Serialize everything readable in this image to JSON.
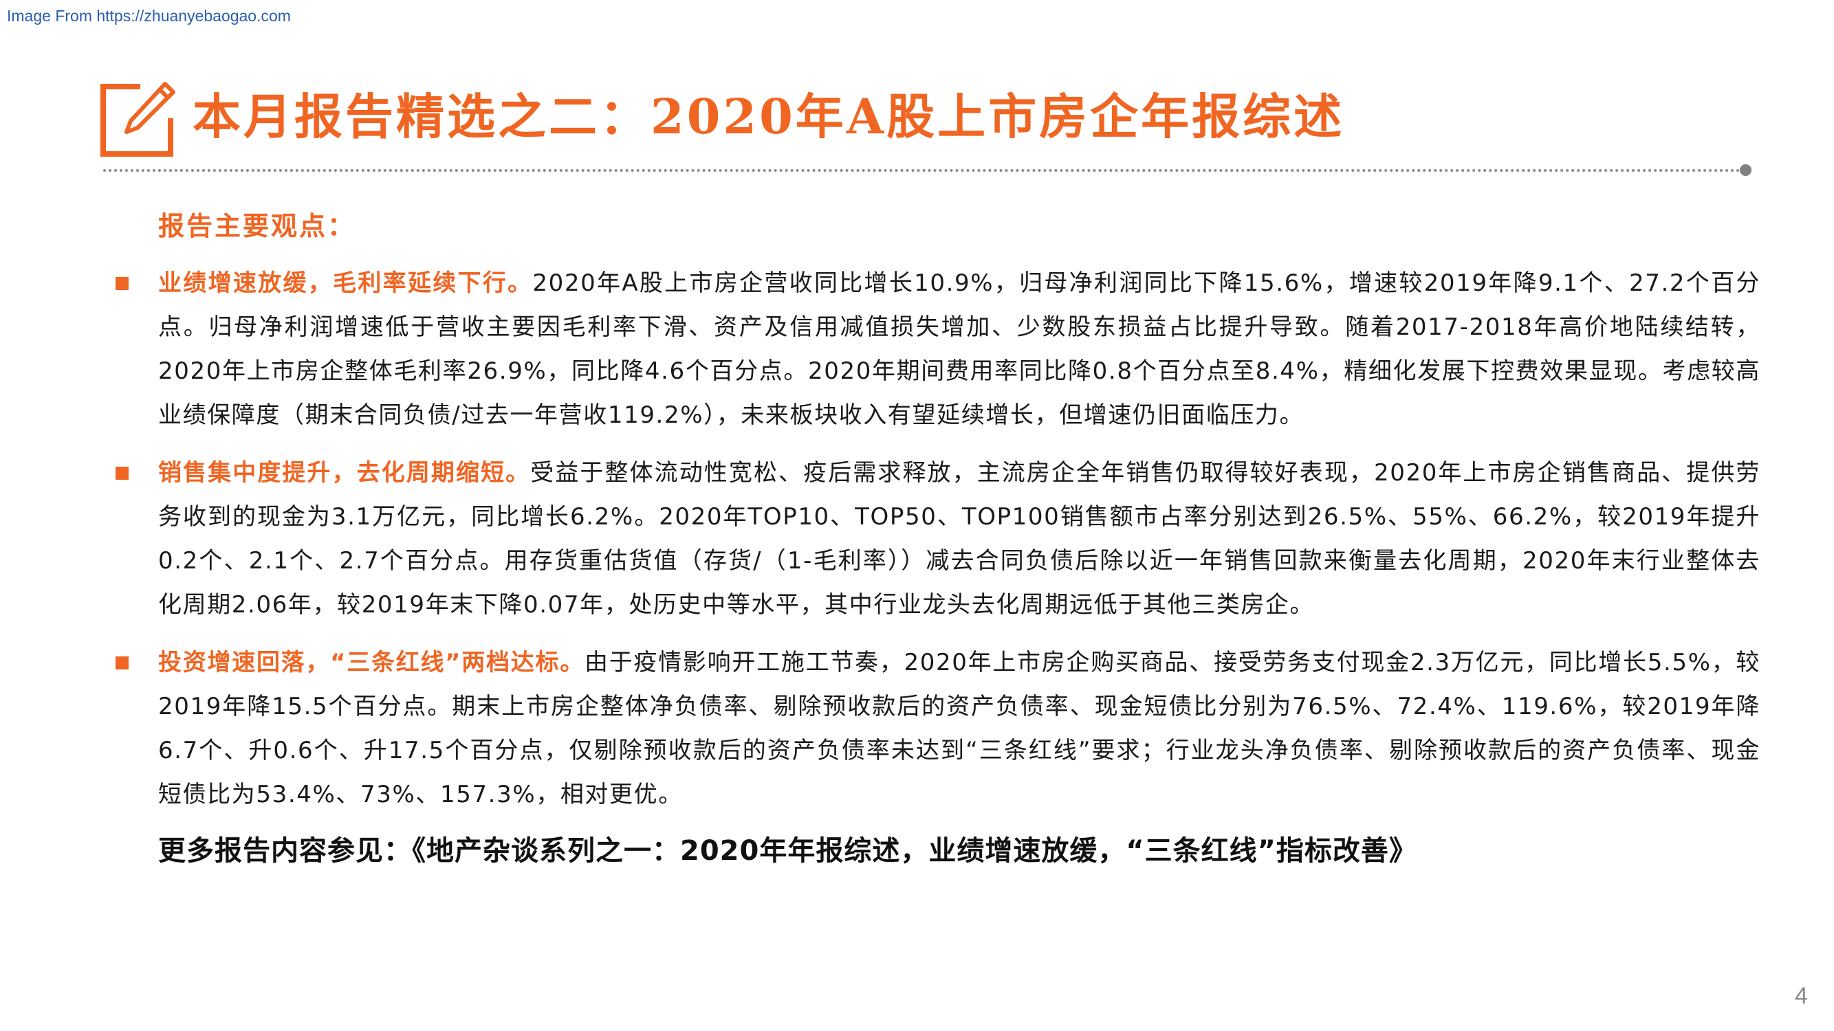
{
  "source_text": "Image From https://zhuanyebaogao.com",
  "slide": {
    "title": "本月报告精选之二：2020年A股上市房企年报综述",
    "section_heading": "报告主要观点：",
    "points": [
      {
        "lead": "业绩增速放缓，毛利率延续下行。",
        "body": "2020年A股上市房企营收同比增长10.9%，归母净利润同比下降15.6%，增速较2019年降9.1个、27.2个百分点。归母净利润增速低于营收主要因毛利率下滑、资产及信用减值损失增加、少数股东损益占比提升导致。随着2017-2018年高价地陆续结转，2020年上市房企整体毛利率26.9%，同比降4.6个百分点。2020年期间费用率同比降0.8个百分点至8.4%，精细化发展下控费效果显现。考虑较高业绩保障度（期末合同负债/过去一年营收119.2%），未来板块收入有望延续增长，但增速仍旧面临压力。"
      },
      {
        "lead": "销售集中度提升，去化周期缩短。",
        "body": "受益于整体流动性宽松、疫后需求释放，主流房企全年销售仍取得较好表现，2020年上市房企销售商品、提供劳务收到的现金为3.1万亿元，同比增长6.2%。2020年TOP10、TOP50、TOP100销售额市占率分别达到26.5%、55%、66.2%，较2019年提升0.2个、2.1个、2.7个百分点。用存货重估货值（存货/（1-毛利率））减去合同负债后除以近一年销售回款来衡量去化周期，2020年末行业整体去化周期2.06年，较2019年末下降0.07年，处历史中等水平，其中行业龙头去化周期远低于其他三类房企。"
      },
      {
        "lead": "投资增速回落，“三条红线”两档达标。",
        "body": "由于疫情影响开工施工节奏，2020年上市房企购买商品、接受劳务支付现金2.3万亿元，同比增长5.5%，较2019年降15.5个百分点。期末上市房企整体净负债率、剔除预收款后的资产负债率、现金短债比分别为76.5%、72.4%、119.6%，较2019年降6.7个、升0.6个、升17.5个百分点，仅剔除预收款后的资产负债率未达到“三条红线”要求；行业龙头净负债率、剔除预收款后的资产负债率、现金短债比为53.4%、73%、157.3%，相对更优。"
      }
    ],
    "more_text": "更多报告内容参见：《地产杂谈系列之一：2020年年报综述，业绩增速放缓，“三条红线”指标改善》",
    "page_number": "4"
  },
  "icons": {
    "logo": "edit-note-icon",
    "bullet": "square-bullet-icon"
  },
  "colors": {
    "accent": "#f06522",
    "body_text": "#1a1a1a",
    "rule": "#8c8c8c",
    "source_link": "#2a5db0"
  }
}
